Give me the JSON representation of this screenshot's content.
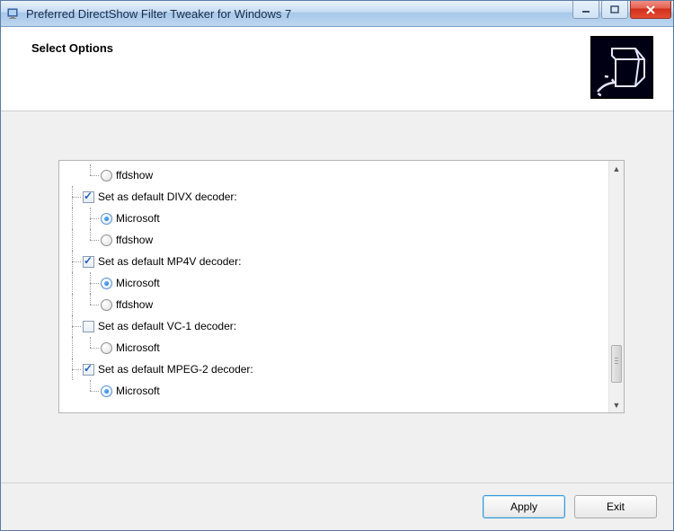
{
  "window": {
    "title": "Preferred DirectShow Filter Tweaker for Windows 7"
  },
  "header": {
    "title": "Select Options"
  },
  "tree": {
    "orphan_option": "ffdshow",
    "groups": [
      {
        "label": "Set as default DIVX decoder:",
        "checked": true,
        "options": [
          {
            "label": "Microsoft",
            "selected": true
          },
          {
            "label": "ffdshow",
            "selected": false
          }
        ]
      },
      {
        "label": "Set as default MP4V decoder:",
        "checked": true,
        "options": [
          {
            "label": "Microsoft",
            "selected": true
          },
          {
            "label": "ffdshow",
            "selected": false
          }
        ]
      },
      {
        "label": "Set as default VC-1 decoder:",
        "checked": false,
        "options": [
          {
            "label": "Microsoft",
            "selected": false
          }
        ]
      },
      {
        "label": "Set as default MPEG-2 decoder:",
        "checked": true,
        "options": [
          {
            "label": "Microsoft",
            "selected": true
          }
        ]
      }
    ]
  },
  "footer": {
    "apply": "Apply",
    "exit": "Exit"
  }
}
